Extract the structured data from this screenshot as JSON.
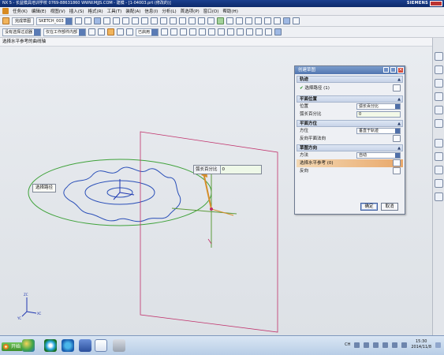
{
  "window": {
    "title": "NX 5 - 长益模具培训学校  0769-88631860 WWW.MJJS.COM - 建模 - [1-04003.prt (修改的)]",
    "brand": "SIEMENS"
  },
  "menu": [
    "任务(K)",
    "编辑(E)",
    "视图(V)",
    "插入(S)",
    "格式(R)",
    "工具(T)",
    "装配(A)",
    "信息(I)",
    "分析(L)",
    "首选项(P)",
    "窗口(O)",
    "帮助(H)"
  ],
  "toolbar": {
    "filter_value": "没有选择过滤器",
    "scope_value": "仅在工作部件内部",
    "sketch_label": "完成草图",
    "sketch_name": "SKETCH_003",
    "snap_value": "已启用"
  },
  "cue_line": "选择水平参考的曲线轴",
  "dialog": {
    "title": "创建草图",
    "sections": {
      "path": {
        "header": "轨迹",
        "select_label": "选择路径 (1)"
      },
      "plane_position": {
        "header": "平面位置",
        "position_label": "位置",
        "position_value": "弧长百分比",
        "arc_percent_label": "弧长百分比",
        "arc_percent_value": "0"
      },
      "plane_orientation": {
        "header": "平面方位",
        "orientation_label": "方位",
        "orientation_value": "垂直于轨迹",
        "reverse_label": "反向平面法向"
      },
      "sketch_orientation": {
        "header": "草图方向",
        "method_label": "方法",
        "method_value": "自动",
        "select_horizontal_label": "选择水平参考 (0)",
        "reverse_label": "反向"
      }
    },
    "ok_label": "确定",
    "cancel_label": "取消"
  },
  "canvas": {
    "path_tag": "选择路径",
    "dyn_input_label": "弧长百分比",
    "dyn_input_value": "0",
    "axis_labels": [
      "XC",
      "YC",
      "ZC"
    ]
  },
  "taskbar": {
    "start_label": "开始",
    "ime_label": "CH",
    "time": "15:30",
    "date": "2014/11/8"
  }
}
